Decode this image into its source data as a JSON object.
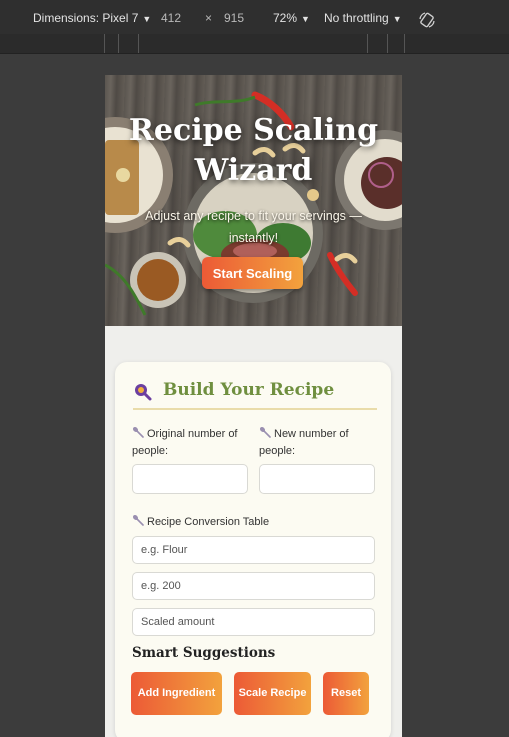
{
  "devtools": {
    "dimensions_label": "Dimensions: Pixel 7",
    "width": "412",
    "times": "×",
    "height": "915",
    "zoom": "72%",
    "throttling": "No throttling"
  },
  "hero": {
    "title": "Recipe Scaling Wizard",
    "subtitle": "Adjust any recipe to fit your servings — instantly!",
    "cta_label": "Start Scaling"
  },
  "form": {
    "title": "Build Your Recipe",
    "original_label": "Original number of people:",
    "new_label": "New number of people:",
    "table_label": "Recipe Conversion Table",
    "ingredient_placeholder": "e.g. Flour",
    "amount_placeholder": "e.g. 200",
    "scaled_placeholder": "Scaled amount",
    "suggestions_title": "Smart Suggestions",
    "buttons": {
      "add_ingredient": "Add Ingredient",
      "scale_recipe": "Scale Recipe",
      "reset": "Reset"
    }
  },
  "colors": {
    "accent_start": "#ec5a36",
    "accent_end": "#f2a23d",
    "title_green": "#6f8f3f",
    "icon_purple": "#6b3fa0"
  }
}
